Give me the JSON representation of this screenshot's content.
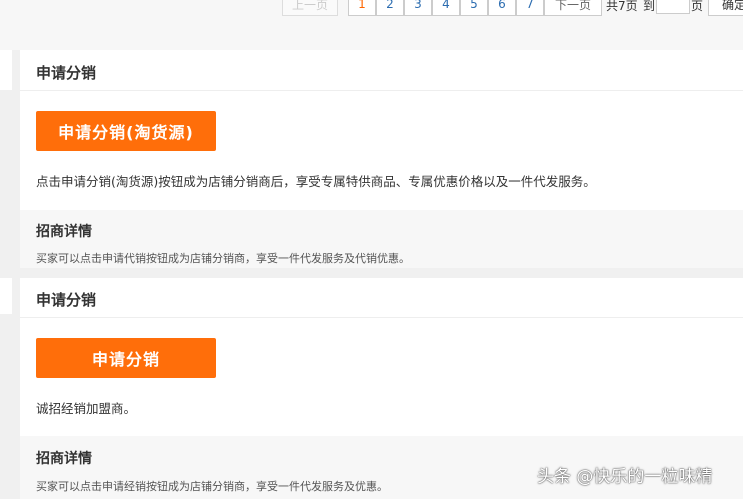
{
  "pagination": {
    "prev_label": "上一页",
    "pages": [
      "1",
      "2",
      "3",
      "4",
      "5",
      "6",
      "7"
    ],
    "current_page": "1",
    "next_label": "下一页",
    "total_label": "共7页",
    "goto_label": "到",
    "page_unit_label": "页",
    "confirm_label": "确定",
    "page_input_value": ""
  },
  "cards": [
    {
      "title": "申请分销",
      "button_label": "申请分销(淘货源)",
      "description": "点击申请分销(淘货源)按钮成为店铺分销商后，享受专属特供商品、专属优惠价格以及一件代发服务。",
      "detail_title": "招商详情",
      "detail_text": "买家可以点击申请代销按钮成为店铺分销商，享受一件代发服务及代销优惠。"
    },
    {
      "title": "申请分销",
      "button_label": "申请分销",
      "description": "诚招经销加盟商。",
      "detail_title": "招商详情",
      "detail_text": "买家可以点击申请经销按钮成为店铺分销商，享受一件代发服务及优惠。"
    }
  ],
  "watermark": "头条 @快乐的一粒味精",
  "colors": {
    "accent": "#ff6e0a",
    "active_page": "#ff6600",
    "link": "#2b6cb0"
  }
}
